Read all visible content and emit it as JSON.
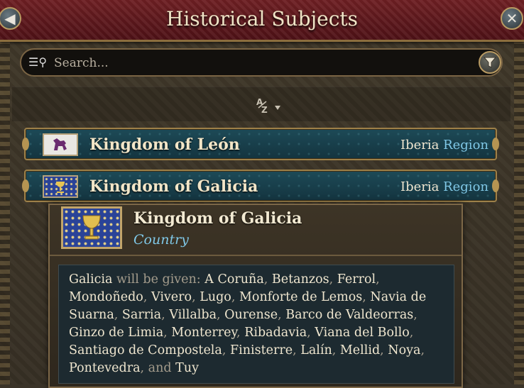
{
  "window": {
    "title": "Historical Subjects"
  },
  "search": {
    "placeholder": "Search..."
  },
  "sort": {
    "icon": "az-sort-icon"
  },
  "rows": [
    {
      "name": "Kingdom of León",
      "region_name": "Iberia",
      "region_link": "Region"
    },
    {
      "name": "Kingdom of Galicia",
      "region_name": "Iberia",
      "region_link": "Region"
    }
  ],
  "tooltip": {
    "title": "Kingdom of Galicia",
    "type": "Country",
    "subject": "Galicia",
    "intro": "will be given:",
    "places": [
      "A Coruña",
      "Betanzos",
      "Ferrol",
      "Mondoñedo",
      "Vivero",
      "Lugo",
      "Monforte de Lemos",
      "Navia de Suarna",
      "Sarria",
      "Villalba",
      "Ourense",
      "Barco de Valdeorras",
      "Ginzo de Limia",
      "Monterrey",
      "Ribadavia",
      "Viana del Bollo",
      "Santiago de Compostela",
      "Finisterre",
      "Lalín",
      "Mellid",
      "Noya",
      "Pontevedra"
    ],
    "conjunction": "and",
    "last_place": "Tuy"
  }
}
